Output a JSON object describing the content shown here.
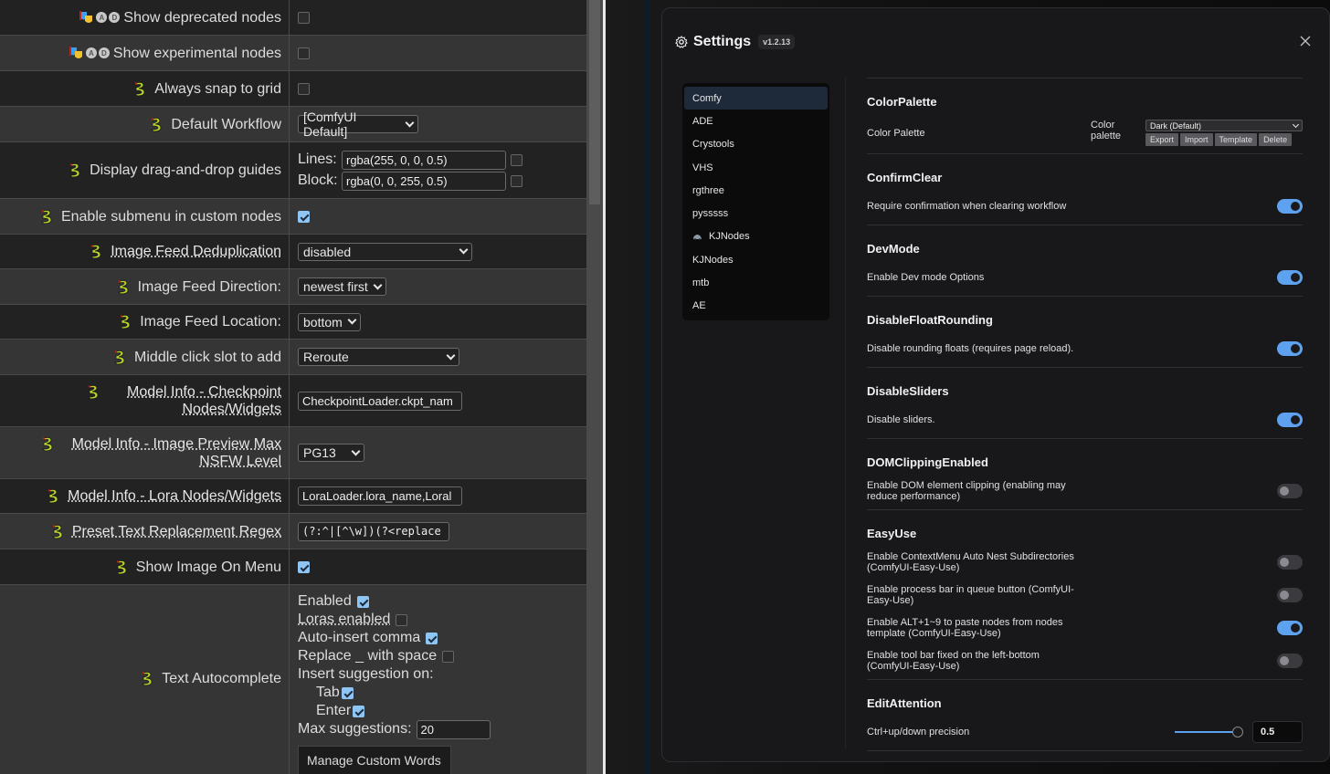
{
  "legacy_settings": {
    "rows": [
      {
        "label": "Show deprecated nodes",
        "control": "checkbox",
        "checked": false,
        "icon": "comfy-masks-icon"
      },
      {
        "label": "Show experimental nodes",
        "control": "checkbox",
        "checked": false,
        "icon": "comfy-masks-icon"
      },
      {
        "label": "Always snap to grid",
        "control": "checkbox",
        "checked": false,
        "icon": "pysssss-snake-icon"
      },
      {
        "label": "Default Workflow",
        "control": "select",
        "value": "[ComfyUI Default]",
        "icon": "pysssss-snake-icon"
      },
      {
        "label": "Display drag-and-drop guides",
        "icon": "pysssss-snake-icon",
        "lines_label": "Lines:",
        "lines_value": "rgba(255, 0, 0, 0.5)",
        "lines_checked": false,
        "block_label": "Block:",
        "block_value": "rgba(0, 0, 255, 0.5)",
        "block_checked": false
      },
      {
        "label": "Enable submenu in custom nodes",
        "control": "checkbox",
        "checked": true,
        "icon": "pysssss-snake-icon"
      },
      {
        "label": "Image Feed Deduplication",
        "control": "select",
        "value": "disabled",
        "icon": "pysssss-snake-icon"
      },
      {
        "label": "Image Feed Direction:",
        "control": "select",
        "value": "newest first",
        "icon": "pysssss-snake-icon"
      },
      {
        "label": "Image Feed Location:",
        "control": "select",
        "value": "bottom",
        "icon": "pysssss-snake-icon"
      },
      {
        "label": "Middle click slot to add",
        "control": "select",
        "value": "Reroute",
        "icon": "pysssss-snake-icon"
      },
      {
        "label": "Model Info - Checkpoint Nodes/Widgets",
        "control": "text",
        "value": "CheckpointLoader.ckpt_nam",
        "icon": "pysssss-snake-icon"
      },
      {
        "label": "Model Info - Image Preview Max NSFW Level",
        "control": "select",
        "value": "PG13",
        "icon": "pysssss-snake-icon"
      },
      {
        "label": "Model Info - Lora Nodes/Widgets",
        "control": "text",
        "value": "LoraLoader.lora_name,Loral",
        "icon": "pysssss-snake-icon"
      },
      {
        "label": "Preset Text Replacement Regex",
        "control": "text",
        "value": "(?:^|[^\\w])(?<replace",
        "icon": "pysssss-snake-icon"
      },
      {
        "label": "Show Image On Menu",
        "control": "checkbox",
        "checked": true,
        "icon": "pysssss-snake-icon"
      }
    ],
    "text_autocomplete": {
      "label": "Text Autocomplete",
      "enabled_label": "Enabled",
      "enabled": true,
      "loras_label": "Loras enabled",
      "loras": false,
      "comma_label": "Auto-insert comma",
      "comma": true,
      "replace_label": "Replace _ with space",
      "replace": false,
      "insert_label": "Insert suggestion on:",
      "tab_label": "Tab",
      "tab": true,
      "enter_label": "Enter",
      "enter": true,
      "max_label": "Max suggestions:",
      "max_value": "20",
      "manage_button": "Manage Custom Words"
    }
  },
  "dialog": {
    "title": "Settings",
    "version": "v1.2.13",
    "nav": [
      {
        "label": "Comfy",
        "active": true
      },
      {
        "label": "ADE"
      },
      {
        "label": "Crystools"
      },
      {
        "label": "VHS"
      },
      {
        "label": "rgthree"
      },
      {
        "label": "pysssss"
      },
      {
        "label": "KJNodes",
        "icon": "car-icon"
      },
      {
        "label": "KJNodes"
      },
      {
        "label": "mtb"
      },
      {
        "label": "AE"
      }
    ],
    "sections": {
      "color_palette": {
        "title": "ColorPalette",
        "row_label": "Color Palette",
        "control_label": "Color palette",
        "selected": "Dark (Default)",
        "buttons": [
          "Export",
          "Import",
          "Template",
          "Delete"
        ]
      },
      "confirm_clear": {
        "title": "ConfirmClear",
        "desc": "Require confirmation when clearing workflow",
        "on": true
      },
      "dev_mode": {
        "title": "DevMode",
        "desc": "Enable Dev mode Options",
        "on": true
      },
      "float_rounding": {
        "title": "DisableFloatRounding",
        "desc": "Disable rounding floats (requires page reload).",
        "on": true
      },
      "sliders": {
        "title": "DisableSliders",
        "desc": "Disable sliders.",
        "on": true
      },
      "dom_clipping": {
        "title": "DOMClippingEnabled",
        "desc": "Enable DOM element clipping (enabling may reduce performance)",
        "on": false
      },
      "easy_use": {
        "title": "EasyUse",
        "rows": [
          {
            "desc": "Enable ContextMenu Auto Nest Subdirectories (ComfyUI-Easy-Use)",
            "on": false
          },
          {
            "desc": "Enable process bar in queue button (ComfyUI-Easy-Use)",
            "on": false
          },
          {
            "desc": "Enable ALT+1~9 to paste nodes from nodes template (ComfyUI-Easy-Use)",
            "on": true
          },
          {
            "desc": "Enable tool bar fixed on the left-bottom (ComfyUI-Easy-Use)",
            "on": false
          }
        ]
      },
      "edit_attention": {
        "title": "EditAttention",
        "desc": "Ctrl+up/down precision",
        "value": "0.5",
        "slider_fraction": 1.0
      }
    },
    "accent_color": "#5ea2ef"
  }
}
